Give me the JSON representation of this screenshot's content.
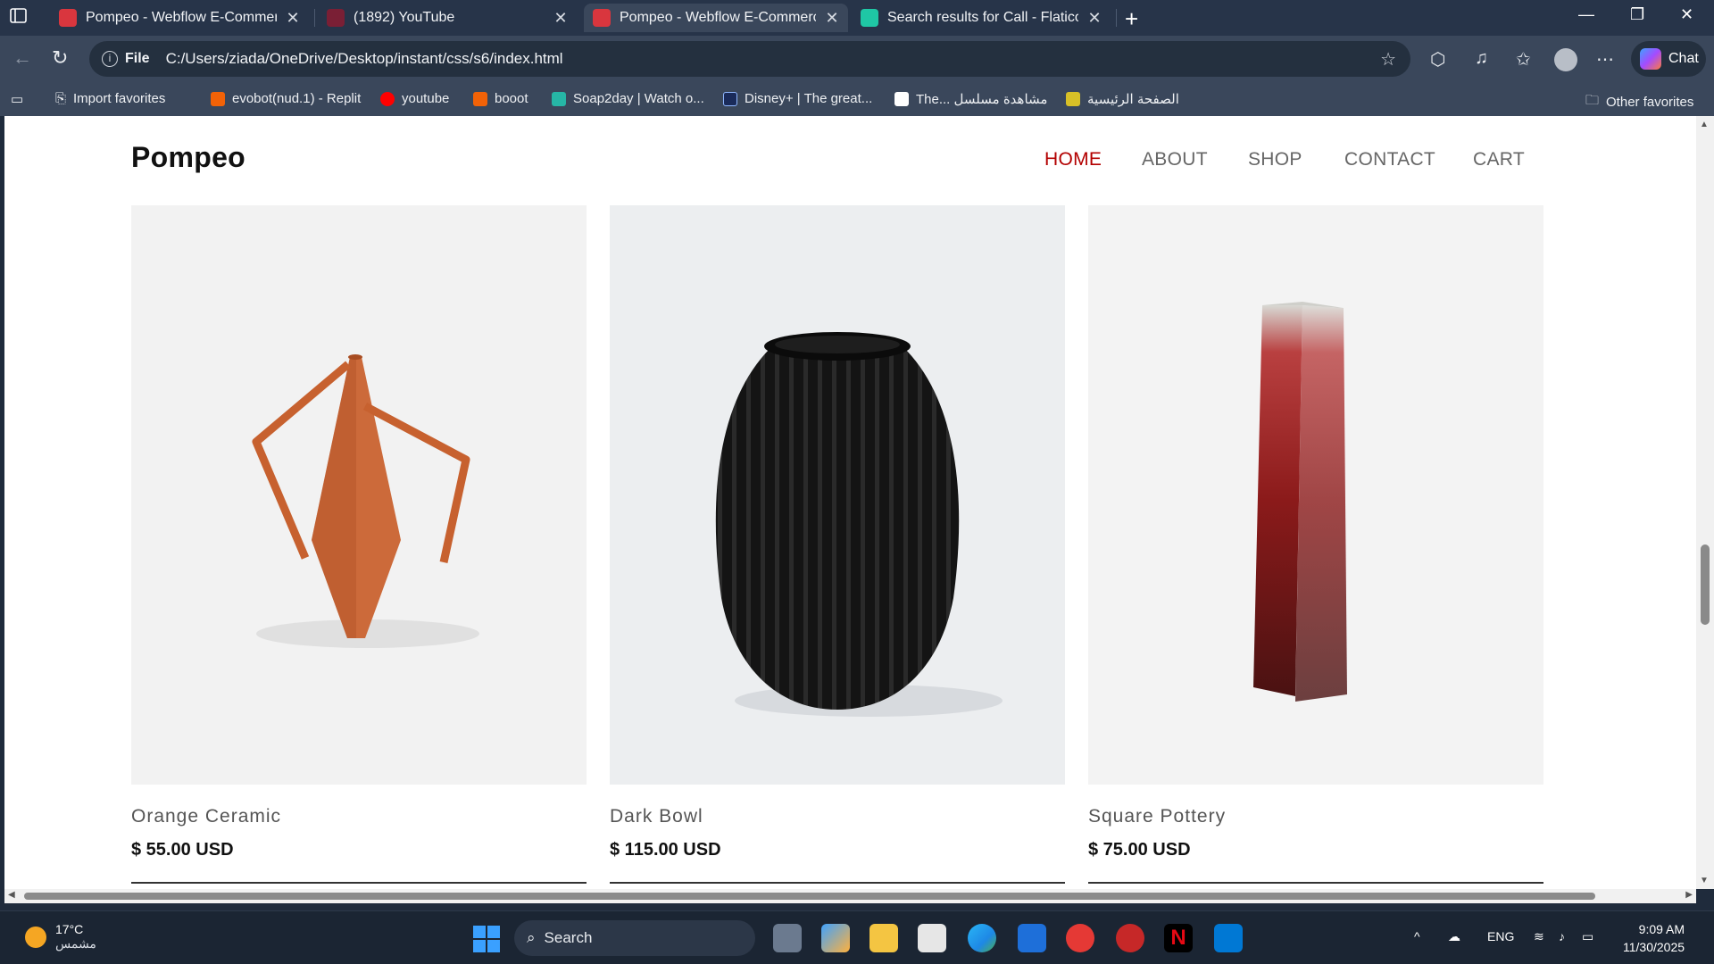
{
  "browser": {
    "tabs": [
      {
        "title": "Pompeo - Webflow E-Commerce",
        "active": false,
        "favicon_color": "#d9363e"
      },
      {
        "title": "(1892) YouTube",
        "active": false,
        "favicon_color": "#c4302b"
      },
      {
        "title": "Pompeo - Webflow E-Commerce",
        "active": true,
        "favicon_color": "#d9363e"
      },
      {
        "title": "Search results for Call - Flaticon",
        "active": false,
        "favicon_color": "#1fc7a5"
      }
    ],
    "address": {
      "scheme": "File",
      "url": "C:/Users/ziada/OneDrive/Desktop/instant/css/s6/index.html"
    },
    "chat_label": "Chat",
    "favorites": [
      {
        "label": "Import favorites",
        "icon": "import-icon"
      },
      {
        "label": "evobot(nud.1) - Replit",
        "icon": "replit-icon",
        "color": "#f26207"
      },
      {
        "label": "youtube",
        "icon": "youtube-icon",
        "color": "#ff0000"
      },
      {
        "label": "booot",
        "icon": "replit-icon",
        "color": "#f26207"
      },
      {
        "label": "Soap2day | Watch o...",
        "icon": "soap2day-icon",
        "color": "#26b6a6"
      },
      {
        "label": "Disney+ | The great...",
        "icon": "disney-icon",
        "color": "#1a2b5a"
      },
      {
        "label": "The... مشاهدة مسلسل",
        "icon": "site-icon",
        "color": "#ffffff"
      },
      {
        "label": "الصفحة الرئيسية",
        "icon": "home-site-icon",
        "color": "#d8c027"
      }
    ],
    "other_favorites": "Other favorites"
  },
  "site": {
    "brand": "Pompeo",
    "nav": [
      "HOME",
      "ABOUT",
      "SHOP",
      "CONTACT",
      "CART"
    ],
    "active_nav": "HOME",
    "accent_color": "#b30000",
    "products": [
      {
        "name": "Orange Ceramic",
        "price": "$ 55.00 USD",
        "color": "#cc6a3a"
      },
      {
        "name": "Dark Bowl",
        "price": "$ 115.00 USD",
        "color": "#111111"
      },
      {
        "name": "Square Pottery",
        "price": "$ 75.00 USD",
        "color": "#8b1a1a"
      }
    ]
  },
  "taskbar": {
    "weather_temp": "17°C",
    "weather_desc": "مشمس",
    "search_placeholder": "Search",
    "language": "ENG",
    "time": "9:09 AM",
    "date": "11/30/2025"
  }
}
